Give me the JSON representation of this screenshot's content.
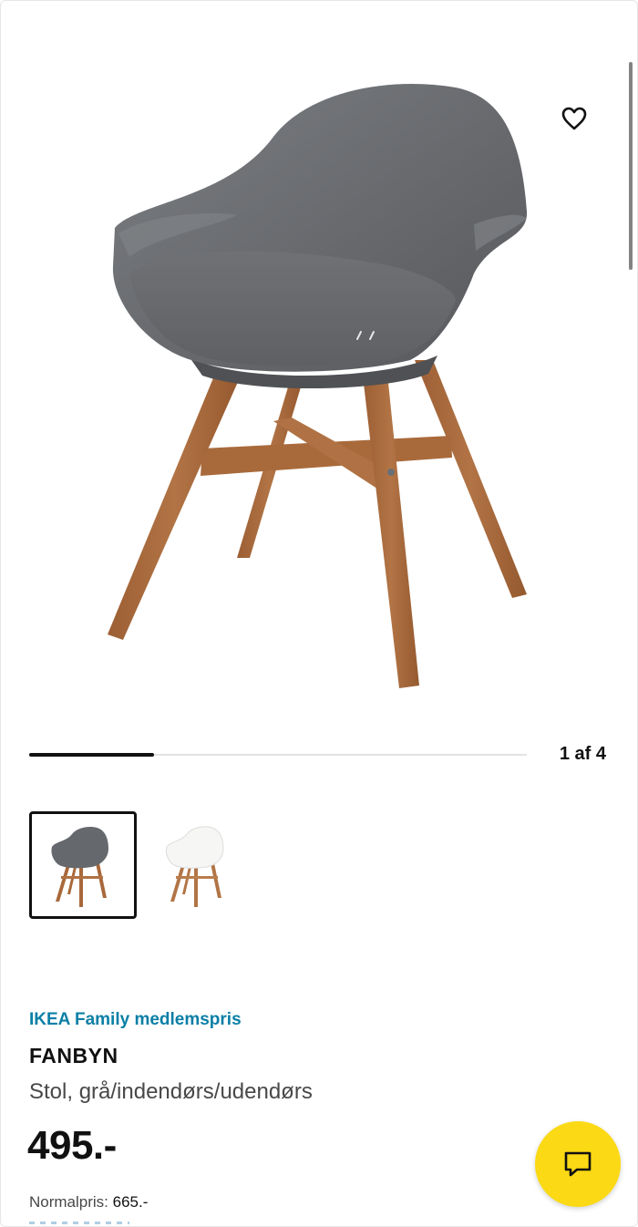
{
  "gallery": {
    "counter": "1 af 4",
    "current_index": 1,
    "total_images": 4,
    "progress_fraction": 0.25,
    "thumbnails": [
      {
        "variant": "grey",
        "selected": true
      },
      {
        "variant": "white",
        "selected": false
      }
    ]
  },
  "product": {
    "family_label": "IKEA Family medlemspris",
    "name": "FANBYN",
    "description": "Stol, grå/indendørs/udendørs",
    "price": "495.-",
    "normal_price_label": "Normalpris:",
    "normal_price_value": "665.-"
  },
  "icons": {
    "favourite": "heart-outline-icon",
    "chat": "chat-bubble-icon"
  },
  "colors": {
    "accent_blue": "#0a7fa6",
    "chat_yellow": "#fbd914",
    "seat_grey": "#6b6e72",
    "leg_wood": "#a8683a"
  }
}
